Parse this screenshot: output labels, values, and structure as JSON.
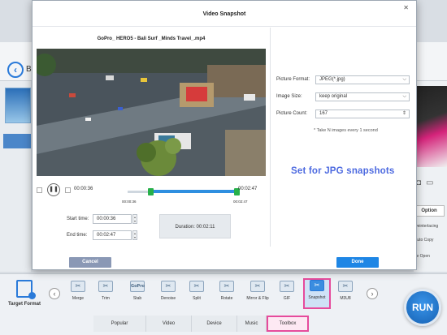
{
  "background_app": {
    "back_label": "Ba",
    "option_label": "Option",
    "deinterlacing_label": "Deinterlacing",
    "auto_copy_label": "Auto Copy",
    "open_label": "se  Open"
  },
  "dialog": {
    "title": "Video Snapshot",
    "close_icon": "x-icon",
    "filename": "GoPro_ HERO5 - Bali Surf _Minds Travel_.mp4",
    "player": {
      "current_time": "00:00:36",
      "end_time": "00:02:47",
      "marker_start": "00:00:36",
      "marker_end": "00:02:47",
      "trim_start_fraction": 0.2156,
      "trim_end_fraction": 1.0
    },
    "start_time_label": "Start time:",
    "start_time_value": "00:00:36",
    "end_time_label": "End time:",
    "end_time_value": "00:02:47",
    "duration_text": "Duration:  00:02:11",
    "settings": {
      "picture_format_label": "Picture Format:",
      "picture_format_value": "JPEG(*.jpg)",
      "image_size_label": "Image Size:",
      "image_size_value": "keep original",
      "picture_count_label": "Picture Count:",
      "picture_count_value": "167",
      "note": "* Take N images every 1 second"
    },
    "callout": "Set for JPG snapshots",
    "cancel_label": "Cancel",
    "done_label": "Done"
  },
  "toolbox": {
    "target_format_label": "Target Format",
    "tools": [
      {
        "label": "Merge",
        "icon": "merge-icon"
      },
      {
        "label": "Trim",
        "icon": "trim-icon"
      },
      {
        "label": "Stab",
        "icon": "gopro-stab-icon",
        "badge": "GoPro"
      },
      {
        "label": "Denoise",
        "icon": "denoise-icon"
      },
      {
        "label": "Split",
        "icon": "split-icon"
      },
      {
        "label": "Rotate",
        "icon": "rotate-icon"
      },
      {
        "label": "Mirror & Flip",
        "icon": "mirror-flip-icon"
      },
      {
        "label": "GIF",
        "icon": "gif-icon"
      },
      {
        "label": "Snapshot",
        "icon": "snapshot-icon",
        "selected": true
      },
      {
        "label": "M3U8",
        "icon": "m3u8-icon"
      }
    ],
    "tabs": [
      "Popular",
      "Video",
      "Device",
      "Music",
      "Toolbox"
    ],
    "active_tab": "Toolbox",
    "run_label": "RUN"
  },
  "colors": {
    "accent": "#1e86e5",
    "highlight": "#e64b9c",
    "callout": "#4d6ae0",
    "trim_handle": "#27b04a"
  }
}
